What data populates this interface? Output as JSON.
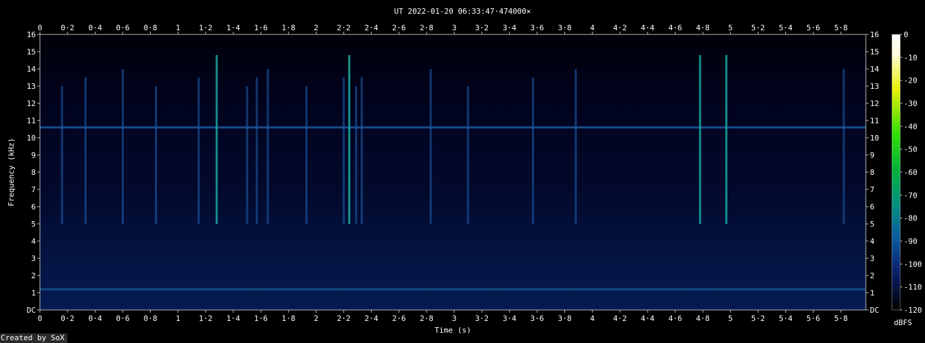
{
  "chart_data": {
    "type": "heatmap",
    "title": "UT 2022-01-20 06:33:47·474000×",
    "xlabel": "Time (s)",
    "ylabel": "Frequency (kHz)",
    "xlim": [
      0,
      5.98
    ],
    "ylim": [
      0,
      16
    ],
    "x_ticks": [
      "0",
      "0·2",
      "0·4",
      "0·6",
      "0·8",
      "1",
      "1·2",
      "1·4",
      "1·6",
      "1·8",
      "2",
      "2·2",
      "2·4",
      "2·6",
      "2·8",
      "3",
      "3·2",
      "3·4",
      "3·6",
      "3·8",
      "4",
      "4·2",
      "4·4",
      "4·6",
      "4·8",
      "5",
      "5·2",
      "5·4",
      "5·6",
      "5·8"
    ],
    "y_ticks": [
      "DC",
      "1",
      "2",
      "3",
      "4",
      "5",
      "6",
      "7",
      "8",
      "9",
      "10",
      "11",
      "12",
      "13",
      "14",
      "15",
      "16"
    ],
    "colorbar": {
      "label": "dBFS",
      "range": [
        -120,
        0
      ],
      "ticks": [
        "0",
        "-10",
        "-20",
        "-30",
        "-40",
        "-50",
        "-60",
        "-70",
        "-80",
        "-90",
        "-100",
        "-110",
        "-120"
      ]
    },
    "features": {
      "horizontal_lines_khz": [
        10.6,
        1.2
      ],
      "broadband_event_times_s": [
        0.16,
        0.33,
        0.6,
        0.84,
        1.15,
        1.28,
        1.5,
        1.57,
        1.65,
        1.93,
        2.2,
        2.24,
        2.29,
        2.33,
        2.83,
        3.1,
        3.57,
        3.88,
        4.78,
        4.97,
        5.82
      ]
    }
  },
  "credit": "Created by SoX"
}
